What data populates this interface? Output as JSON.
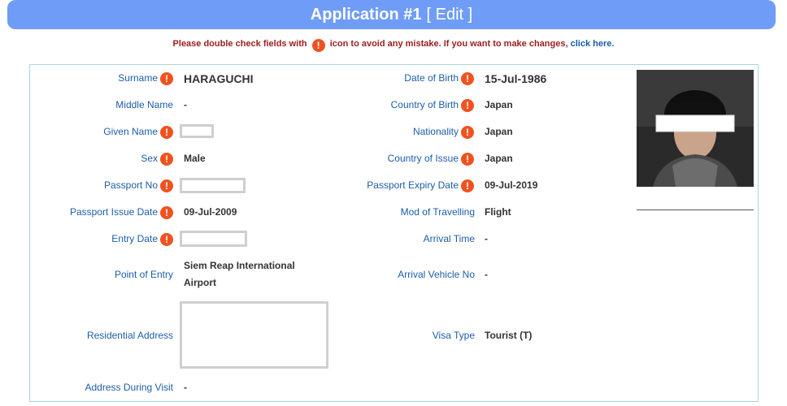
{
  "header": {
    "title": "Application #1",
    "edit_label": "[ Edit ]"
  },
  "notice": {
    "text_before": "Please double check fields with",
    "text_after": "icon to avoid any mistake. If you want to make changes,",
    "link": "click here."
  },
  "icons": {
    "warning": "!"
  },
  "colors": {
    "header_bg": "#6f9cf6",
    "label": "#1d5ea8",
    "warning": "#f0521f",
    "notice": "#9c1d1d"
  },
  "left_fields": [
    {
      "label": "Surname",
      "value": "HARAGUCHI",
      "warn": true
    },
    {
      "label": "Middle Name",
      "value": "-",
      "warn": false
    },
    {
      "label": "Given Name",
      "value": "",
      "warn": true
    },
    {
      "label": "Sex",
      "value": "Male",
      "warn": true
    },
    {
      "label": "Passport No",
      "value": "",
      "warn": true
    },
    {
      "label": "Passport Issue Date",
      "value": "09-Jul-2009",
      "warn": true
    },
    {
      "label": "Entry Date",
      "value": "",
      "warn": true
    },
    {
      "label": "Point of Entry",
      "value_line1": "Siem Reap International",
      "value_line2": "Airport"
    },
    {
      "label": "Residential Address",
      "value": ""
    },
    {
      "label": "Address During Visit",
      "value": "-"
    }
  ],
  "right_fields": [
    {
      "label": "Date of Birth",
      "value": "15-Jul-1986",
      "warn": true
    },
    {
      "label": "Country of Birth",
      "value": "Japan",
      "warn": true
    },
    {
      "label": "Nationality",
      "value": "Japan",
      "warn": true
    },
    {
      "label": "Country of Issue",
      "value": "Japan",
      "warn": true
    },
    {
      "label": "Passport Expiry Date",
      "value": "09-Jul-2019",
      "warn": true
    },
    {
      "label": "Mod of Travelling",
      "value": "Flight"
    },
    {
      "label": "Arrival Time",
      "value": "-"
    },
    {
      "label": "Arrival Vehicle No",
      "value": "-"
    },
    {
      "label": "Visa Type",
      "value": "Tourist (T)"
    }
  ]
}
